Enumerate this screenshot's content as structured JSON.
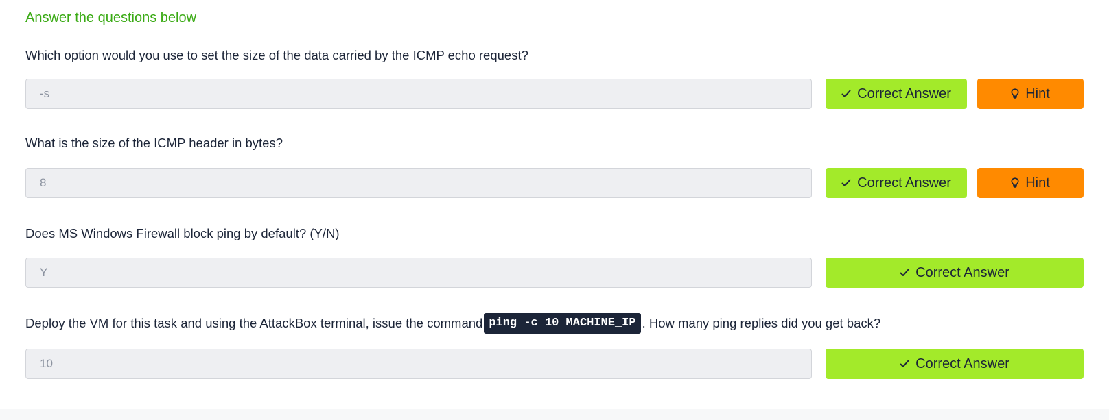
{
  "section": {
    "title": "Answer the questions below"
  },
  "questions": [
    {
      "text": "Which option would you use to set the size of the data carried by the ICMP echo request?",
      "answer": "-s",
      "correct_label": "Correct Answer",
      "hint_label": "Hint"
    },
    {
      "text": "What is the size of the ICMP header in bytes?",
      "answer": "8",
      "correct_label": "Correct Answer",
      "hint_label": "Hint"
    },
    {
      "text": "Does MS Windows Firewall block ping by default? (Y/N)",
      "answer": "Y",
      "correct_label": "Correct Answer"
    },
    {
      "text_before": "Deploy the VM for this task and using the AttackBox terminal, issue the command ",
      "code": "ping -c 10 MACHINE_IP",
      "text_after": ". How many ping replies did you get back?",
      "answer": "10",
      "correct_label": "Correct Answer"
    }
  ],
  "colors": {
    "accent_green": "#3aaa14",
    "correct_button": "#a3ea2a",
    "hint_button": "#ff8a00",
    "text_dark": "#1c2538"
  },
  "icons": {
    "correct": "check-icon",
    "hint": "lightbulb-icon"
  }
}
